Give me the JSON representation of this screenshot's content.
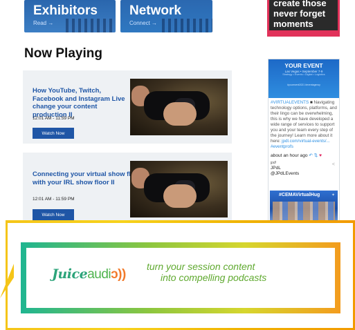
{
  "tiles": [
    {
      "title": "Exhibitors",
      "sub": "Read →"
    },
    {
      "title": "Network",
      "sub": "Connect →"
    }
  ],
  "promo": {
    "lines": [
      "create those",
      "never forget",
      "moments"
    ],
    "color": "#e1325a"
  },
  "now_playing": {
    "title": "Now Playing",
    "sessions": [
      {
        "title": "How YouTube, Twitch, Facebook and Instagram Live change your content production II",
        "time": "12:01 AM - 11:59 PM",
        "button": "Watch Now"
      },
      {
        "title": "Connecting your virtual show floor with your IRL show floor II",
        "time": "12:01 AM - 11:59 PM",
        "button": "Watch Now"
      }
    ]
  },
  "social": {
    "banner_title": "YOUR EVENT",
    "banner_sub": "Las Vegas • September 7-9",
    "banner_sub2": "Strategy • Events • Digital • Logistics",
    "banner_tags": "#yourevent2021   #eventagency",
    "post_hashtag": "#VIRTUALEVENTS",
    "post_text": "Navigating technology options, platforms, and their lingo can be overwhelming, this is why we have developed a wide range of services to support you and your team every step of the journey! Learn more about it here:",
    "post_link": "jpdl.com/virtual-events/...",
    "post_tag": "#eventprofs",
    "post_time": "about an hour ago",
    "account_mark": "jpdl",
    "account_name": "JPdL",
    "account_handle": "@JPdLEvents",
    "image_tag": "#CEMAVirtualHug",
    "accent": "#2b8fe3"
  },
  "ad": {
    "brand_main": "Juice",
    "brand_sub": "audi",
    "brand_waves": "ɔ))",
    "tagline_1": "turn your session content",
    "tagline_2": "into compelling podcasts",
    "frame_color": "#f5c518"
  }
}
